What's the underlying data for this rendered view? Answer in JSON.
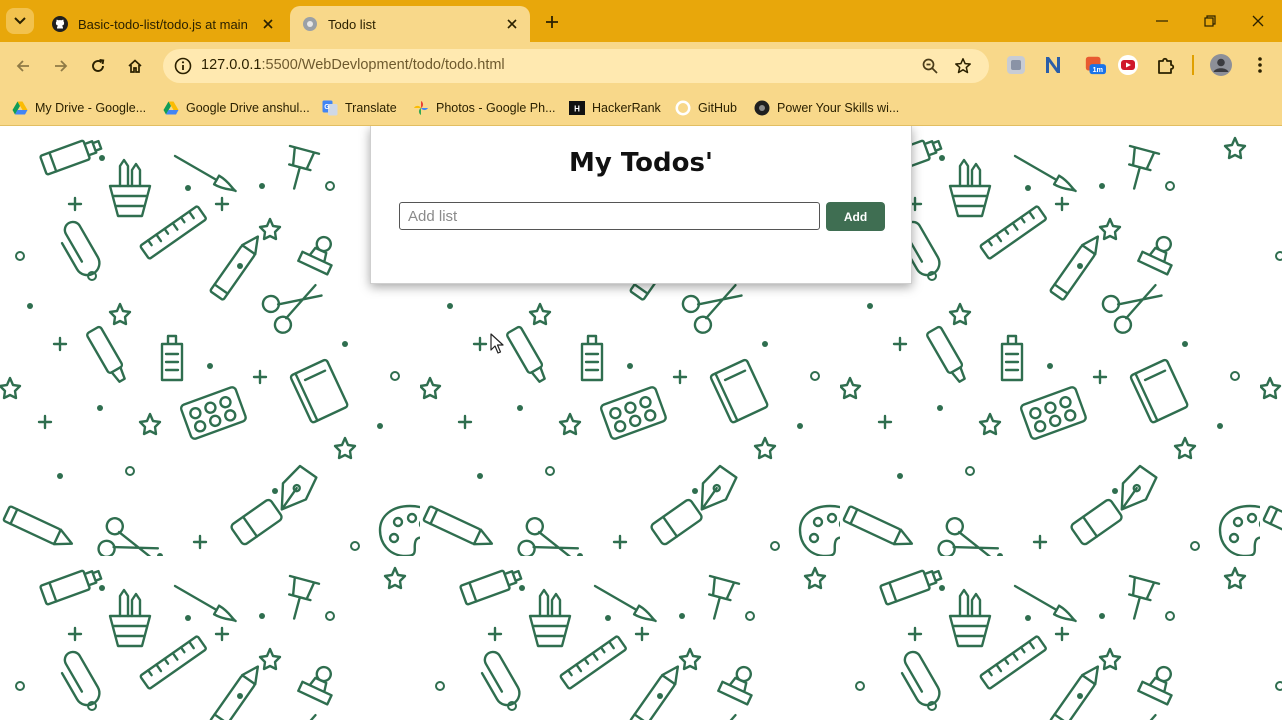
{
  "browser": {
    "tabs": [
      {
        "title": "Basic-todo-list/todo.js at main",
        "active": false
      },
      {
        "title": "Todo list",
        "active": true
      }
    ],
    "url_host": "127.0.0.1",
    "url_rest": ":5500/WebDevlopment/todo/todo.html",
    "extension_badge": "1m",
    "bookmarks": [
      {
        "label": "My Drive - Google...",
        "icon": "google-drive-icon"
      },
      {
        "label": "Google Drive anshul...",
        "icon": "google-drive-icon"
      },
      {
        "label": "Translate",
        "icon": "translate-icon"
      },
      {
        "label": "Photos - Google Ph...",
        "icon": "google-photos-icon"
      },
      {
        "label": "HackerRank",
        "icon": "hackerrank-icon"
      },
      {
        "label": "GitHub",
        "icon": "github-icon"
      },
      {
        "label": "Power Your Skills wi...",
        "icon": "skills-icon"
      }
    ]
  },
  "page": {
    "heading": "My Todos'",
    "input_placeholder": "Add list",
    "input_value": "",
    "add_label": "Add"
  },
  "colors": {
    "chrome_tabstrip": "#e8a70b",
    "chrome_toolbar": "#f8d88a",
    "add_button": "#3f6e52",
    "pattern_stroke": "#2f6e4f"
  }
}
